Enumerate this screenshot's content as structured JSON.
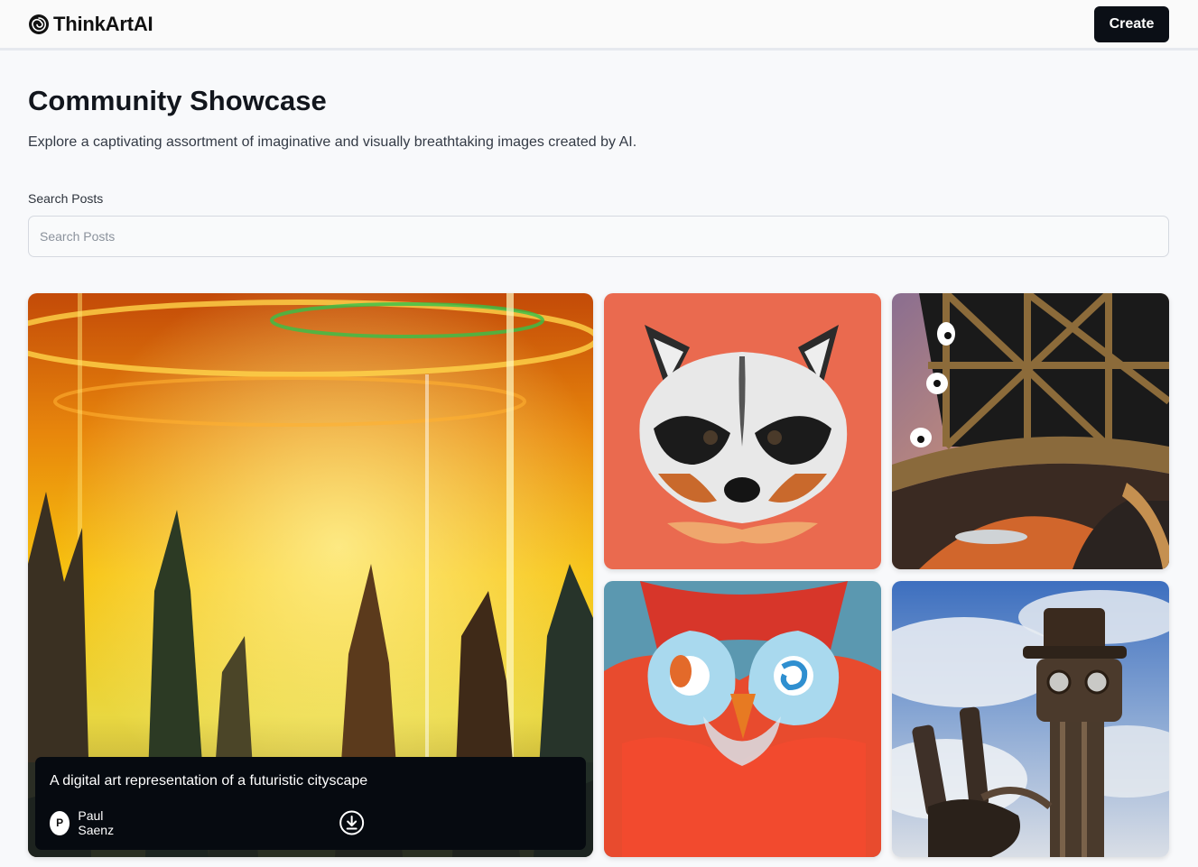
{
  "header": {
    "brand_name": "ThinkArtAI",
    "create_label": "Create"
  },
  "main": {
    "title": "Community Showcase",
    "subtitle": "Explore a captivating assortment of imaginative and visually breathtaking images created by AI.",
    "search": {
      "label": "Search Posts",
      "placeholder": "Search Posts",
      "value": ""
    }
  },
  "gallery": {
    "featured": {
      "prompt": "A digital art representation of a futuristic cityscape",
      "author_initial": "P",
      "author_name": "Paul Saenz"
    },
    "items": [
      {
        "subject": "futuristic cityscape"
      },
      {
        "subject": "raccoon portrait"
      },
      {
        "subject": "steel tower with eyes"
      },
      {
        "subject": "colorful owl"
      },
      {
        "subject": "steampunk robot"
      }
    ]
  },
  "colors": {
    "accent": "#0b0f16",
    "background": "#f8f9fb",
    "raccoon_bg": "#ea6a4f"
  }
}
